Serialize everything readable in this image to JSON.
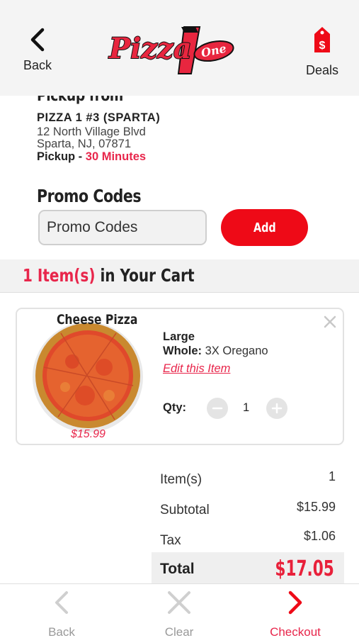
{
  "header": {
    "back_label": "Back",
    "deals_label": "Deals",
    "logo_text": "Pizza",
    "logo_sub": "One"
  },
  "pickup": {
    "heading": "Pickup from",
    "store": "PIZZA 1 #3 (SPARTA)",
    "address_line1": "12 North Village Blvd",
    "address_line2": "Sparta, NJ, 07871",
    "time_label": "Pickup -",
    "time_value": "30 Minutes"
  },
  "promo": {
    "title": "Promo Codes",
    "placeholder": "Promo Codes",
    "add_label": "Add"
  },
  "cart": {
    "count_text": "1 Item(s)",
    "heading_text": "in Your Cart",
    "items": [
      {
        "name": "Cheese Pizza",
        "price": "$15.99",
        "size": "Large",
        "option_label": "Whole:",
        "option_value": "3X Oregano",
        "edit_label": "Edit this Item",
        "qty_label": "Qty:",
        "qty": "1"
      }
    ]
  },
  "summary": {
    "items_label": "Item(s)",
    "items_value": "1",
    "subtotal_label": "Subtotal",
    "subtotal_value": "$15.99",
    "tax_label": "Tax",
    "tax_value": "$1.06",
    "total_label": "Total",
    "total_value": "$17.05"
  },
  "bottom_nav": {
    "back_label": "Back",
    "clear_label": "Clear",
    "checkout_label": "Checkout"
  },
  "colors": {
    "accent": "#e8264b",
    "button_red": "#ee0a17",
    "disabled_gray": "#cfcfcf"
  },
  "icons": [
    "chevron-left-icon",
    "price-tag-icon",
    "close-icon",
    "minus-icon",
    "plus-icon",
    "x-icon",
    "chevron-right-icon"
  ]
}
